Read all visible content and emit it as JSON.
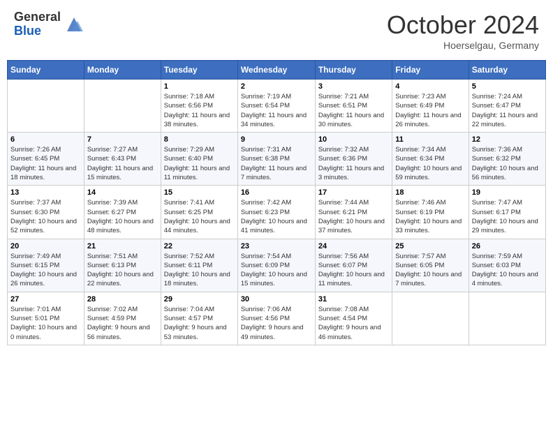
{
  "header": {
    "logo_general": "General",
    "logo_blue": "Blue",
    "month_title": "October 2024",
    "subtitle": "Hoerselgau, Germany"
  },
  "days_of_week": [
    "Sunday",
    "Monday",
    "Tuesday",
    "Wednesday",
    "Thursday",
    "Friday",
    "Saturday"
  ],
  "weeks": [
    [
      {
        "day": "",
        "info": ""
      },
      {
        "day": "",
        "info": ""
      },
      {
        "day": "1",
        "info": "Sunrise: 7:18 AM\nSunset: 6:56 PM\nDaylight: 11 hours and 38 minutes."
      },
      {
        "day": "2",
        "info": "Sunrise: 7:19 AM\nSunset: 6:54 PM\nDaylight: 11 hours and 34 minutes."
      },
      {
        "day": "3",
        "info": "Sunrise: 7:21 AM\nSunset: 6:51 PM\nDaylight: 11 hours and 30 minutes."
      },
      {
        "day": "4",
        "info": "Sunrise: 7:23 AM\nSunset: 6:49 PM\nDaylight: 11 hours and 26 minutes."
      },
      {
        "day": "5",
        "info": "Sunrise: 7:24 AM\nSunset: 6:47 PM\nDaylight: 11 hours and 22 minutes."
      }
    ],
    [
      {
        "day": "6",
        "info": "Sunrise: 7:26 AM\nSunset: 6:45 PM\nDaylight: 11 hours and 18 minutes."
      },
      {
        "day": "7",
        "info": "Sunrise: 7:27 AM\nSunset: 6:43 PM\nDaylight: 11 hours and 15 minutes."
      },
      {
        "day": "8",
        "info": "Sunrise: 7:29 AM\nSunset: 6:40 PM\nDaylight: 11 hours and 11 minutes."
      },
      {
        "day": "9",
        "info": "Sunrise: 7:31 AM\nSunset: 6:38 PM\nDaylight: 11 hours and 7 minutes."
      },
      {
        "day": "10",
        "info": "Sunrise: 7:32 AM\nSunset: 6:36 PM\nDaylight: 11 hours and 3 minutes."
      },
      {
        "day": "11",
        "info": "Sunrise: 7:34 AM\nSunset: 6:34 PM\nDaylight: 10 hours and 59 minutes."
      },
      {
        "day": "12",
        "info": "Sunrise: 7:36 AM\nSunset: 6:32 PM\nDaylight: 10 hours and 56 minutes."
      }
    ],
    [
      {
        "day": "13",
        "info": "Sunrise: 7:37 AM\nSunset: 6:30 PM\nDaylight: 10 hours and 52 minutes."
      },
      {
        "day": "14",
        "info": "Sunrise: 7:39 AM\nSunset: 6:27 PM\nDaylight: 10 hours and 48 minutes."
      },
      {
        "day": "15",
        "info": "Sunrise: 7:41 AM\nSunset: 6:25 PM\nDaylight: 10 hours and 44 minutes."
      },
      {
        "day": "16",
        "info": "Sunrise: 7:42 AM\nSunset: 6:23 PM\nDaylight: 10 hours and 41 minutes."
      },
      {
        "day": "17",
        "info": "Sunrise: 7:44 AM\nSunset: 6:21 PM\nDaylight: 10 hours and 37 minutes."
      },
      {
        "day": "18",
        "info": "Sunrise: 7:46 AM\nSunset: 6:19 PM\nDaylight: 10 hours and 33 minutes."
      },
      {
        "day": "19",
        "info": "Sunrise: 7:47 AM\nSunset: 6:17 PM\nDaylight: 10 hours and 29 minutes."
      }
    ],
    [
      {
        "day": "20",
        "info": "Sunrise: 7:49 AM\nSunset: 6:15 PM\nDaylight: 10 hours and 26 minutes."
      },
      {
        "day": "21",
        "info": "Sunrise: 7:51 AM\nSunset: 6:13 PM\nDaylight: 10 hours and 22 minutes."
      },
      {
        "day": "22",
        "info": "Sunrise: 7:52 AM\nSunset: 6:11 PM\nDaylight: 10 hours and 18 minutes."
      },
      {
        "day": "23",
        "info": "Sunrise: 7:54 AM\nSunset: 6:09 PM\nDaylight: 10 hours and 15 minutes."
      },
      {
        "day": "24",
        "info": "Sunrise: 7:56 AM\nSunset: 6:07 PM\nDaylight: 10 hours and 11 minutes."
      },
      {
        "day": "25",
        "info": "Sunrise: 7:57 AM\nSunset: 6:05 PM\nDaylight: 10 hours and 7 minutes."
      },
      {
        "day": "26",
        "info": "Sunrise: 7:59 AM\nSunset: 6:03 PM\nDaylight: 10 hours and 4 minutes."
      }
    ],
    [
      {
        "day": "27",
        "info": "Sunrise: 7:01 AM\nSunset: 5:01 PM\nDaylight: 10 hours and 0 minutes."
      },
      {
        "day": "28",
        "info": "Sunrise: 7:02 AM\nSunset: 4:59 PM\nDaylight: 9 hours and 56 minutes."
      },
      {
        "day": "29",
        "info": "Sunrise: 7:04 AM\nSunset: 4:57 PM\nDaylight: 9 hours and 53 minutes."
      },
      {
        "day": "30",
        "info": "Sunrise: 7:06 AM\nSunset: 4:56 PM\nDaylight: 9 hours and 49 minutes."
      },
      {
        "day": "31",
        "info": "Sunrise: 7:08 AM\nSunset: 4:54 PM\nDaylight: 9 hours and 46 minutes."
      },
      {
        "day": "",
        "info": ""
      },
      {
        "day": "",
        "info": ""
      }
    ]
  ]
}
